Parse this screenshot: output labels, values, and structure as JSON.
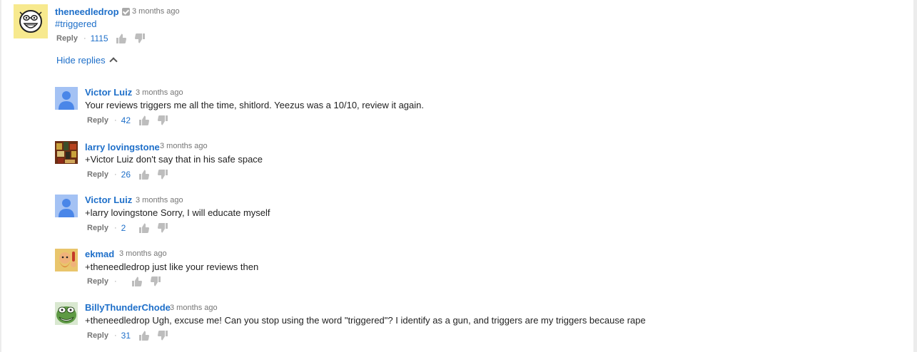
{
  "top_comment": {
    "author": "theneedledrop",
    "time": "3 months ago",
    "text": "#triggered",
    "reply_label": "Reply",
    "separator": "·",
    "likes": "1115"
  },
  "hide_replies_label": "Hide replies",
  "replies": [
    {
      "author": "Victor Luiz",
      "time": "3 months ago",
      "text": "Your reviews triggers me all the time, shitlord. Yeezus was a 10/10, review it again.",
      "reply_label": "Reply",
      "separator": "·",
      "likes": "42"
    },
    {
      "author": "larry lovingstone",
      "time": "3 months ago",
      "text": "+Victor Luiz don't say that in his safe space",
      "reply_label": "Reply",
      "separator": "·",
      "likes": "26"
    },
    {
      "author": "Victor Luiz",
      "time": "3 months ago",
      "text": "+larry lovingstone Sorry, I will educate myself",
      "reply_label": "Reply",
      "separator": "·",
      "likes": "2"
    },
    {
      "author": "ekmad",
      "time": "3 months ago",
      "text": "+theneedledrop just like your reviews then",
      "reply_label": "Reply",
      "separator": "·",
      "likes": ""
    },
    {
      "author": "BillyThunderChode",
      "time": "3 months ago",
      "text": "+theneedledrop Ugh, excuse me! Can you stop using the word \"triggered\"? I identify as a gun, and triggers are my triggers because rape",
      "reply_label": "Reply",
      "separator": "·",
      "likes": "31"
    }
  ],
  "colors": {
    "link": "#1e6fc9",
    "meta": "#767676",
    "text": "#222222",
    "icon": "#bdbdbd"
  }
}
